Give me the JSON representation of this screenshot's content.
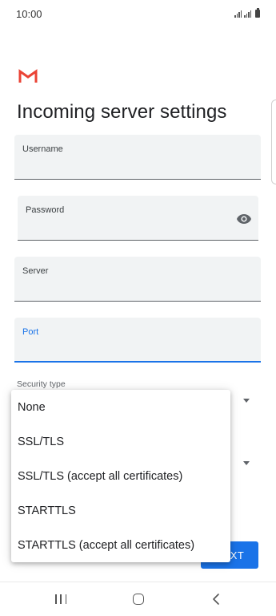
{
  "status_bar": {
    "time": "10:00"
  },
  "header": {
    "title": "Incoming server settings"
  },
  "form": {
    "username": {
      "label": "Username",
      "value": ""
    },
    "password": {
      "label": "Password",
      "value": ""
    },
    "server": {
      "label": "Server",
      "value": ""
    },
    "port": {
      "label": "Port",
      "value": ""
    },
    "security_type": {
      "label": "Security type"
    }
  },
  "dropdown": {
    "options": [
      "None",
      "SSL/TLS",
      "SSL/TLS (accept all certificates)",
      "STARTTLS",
      "STARTTLS (accept all certificates)"
    ]
  },
  "buttons": {
    "next_label": "NEXT"
  },
  "icons": {
    "logo": "gmail-logo-icon",
    "password_toggle": "eye-icon",
    "dropdown": "chevron-down-icon",
    "nav_recents": "recents-icon",
    "nav_home": "home-icon",
    "nav_back": "back-icon"
  },
  "colors": {
    "accent": "#1a73e8",
    "gmail_red": "#ea4335",
    "field_bg": "#f1f3f4"
  }
}
